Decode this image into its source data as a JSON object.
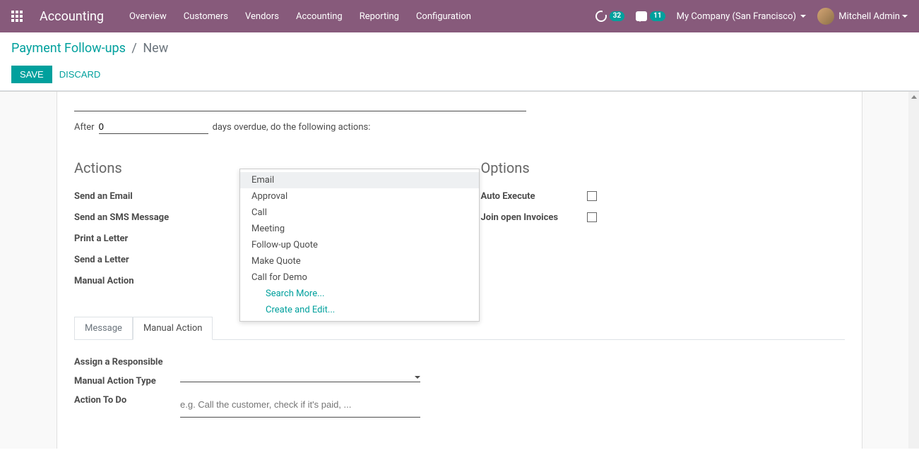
{
  "topnav": {
    "brand": "Accounting",
    "menu": [
      "Overview",
      "Customers",
      "Vendors",
      "Accounting",
      "Reporting",
      "Configuration"
    ],
    "timer_badge": "32",
    "chat_badge": "11",
    "company": "My Company (San Francisco)",
    "user": "Mitchell Admin"
  },
  "breadcrumb": {
    "parent": "Payment Follow-ups",
    "current": "New"
  },
  "buttons": {
    "save": "Save",
    "discard": "Discard"
  },
  "form": {
    "after_label": "After",
    "days_value": "0",
    "after_suffix": "days overdue, do the following actions:",
    "actions_heading": "Actions",
    "options_heading": "Options",
    "actions": {
      "send_email": "Send an Email",
      "send_sms": "Send an SMS Message",
      "print_letter": "Print a Letter",
      "send_letter": "Send a Letter",
      "manual_action": "Manual Action"
    },
    "options": {
      "auto_execute": "Auto Execute",
      "join_invoices": "Join open Invoices"
    },
    "tabs": {
      "message": "Message",
      "manual_action": "Manual Action"
    },
    "manual_tab": {
      "assign_responsible": "Assign a Responsible",
      "manual_action_type": "Manual Action Type",
      "action_to_do": "Action To Do",
      "action_placeholder": "e.g. Call the customer, check if it's paid, ..."
    }
  },
  "dropdown": {
    "items": [
      "Email",
      "Approval",
      "Call",
      "Meeting",
      "Follow-up Quote",
      "Make Quote",
      "Call for Demo"
    ],
    "search_more": "Search More...",
    "create_edit": "Create and Edit..."
  }
}
